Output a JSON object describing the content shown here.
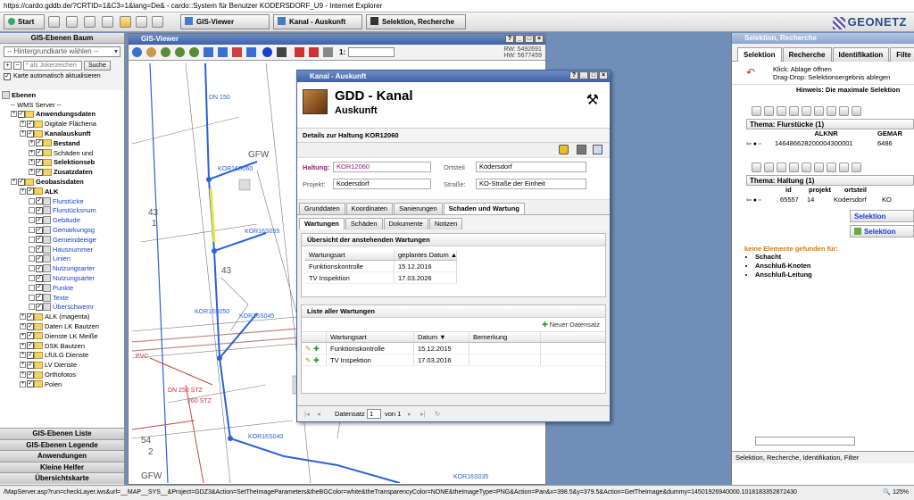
{
  "browser": {
    "title": "https://cardo.gddb.de/?CRTID=1&C3=1&lang=De& - cardo::System für Benutzer KODERSDORF_U9 - Internet Explorer"
  },
  "toolbar": {
    "start_label": "Start",
    "gis_viewer_label": "GIS-Viewer",
    "kanal_auskunft_label": "Kanal - Auskunft",
    "selektion_label": "Selektion, Recherche",
    "logo": "GEONETZ"
  },
  "left": {
    "header": "GIS-Ebenen Baum",
    "dropdown": "-- Hintergrundkarte wählen --",
    "search_placeholder": "* als Jokerzeichen",
    "search_button": "Suche",
    "auto_update": "Karte automatisch aktualisieren",
    "tree": [
      {
        "label": "Ebenen",
        "indent": 0,
        "kind": "root"
      },
      {
        "label": "-- WMS Server --",
        "indent": 1,
        "kind": "plain"
      },
      {
        "label": "Anwendungsdaten",
        "indent": 1,
        "kind": "bold"
      },
      {
        "label": "Digitale Flächena",
        "indent": 2,
        "kind": "folder"
      },
      {
        "label": "Kanalauskunft",
        "indent": 2,
        "kind": "bold"
      },
      {
        "label": "Bestand",
        "indent": 3,
        "kind": "folderbold"
      },
      {
        "label": "Schäden und",
        "indent": 3,
        "kind": "folder"
      },
      {
        "label": "Selektionseb",
        "indent": 3,
        "kind": "folderbold"
      },
      {
        "label": "Zusatzdaten",
        "indent": 3,
        "kind": "folderbold"
      },
      {
        "label": "Geobasisdaten",
        "indent": 1,
        "kind": "bold"
      },
      {
        "label": "ALK",
        "indent": 2,
        "kind": "bold"
      },
      {
        "label": "Flurstücke",
        "indent": 3,
        "kind": "blue"
      },
      {
        "label": "Flurstücksnum",
        "indent": 3,
        "kind": "blue"
      },
      {
        "label": "Gebäude",
        "indent": 3,
        "kind": "blue"
      },
      {
        "label": "Gemarkungsg",
        "indent": 3,
        "kind": "blue"
      },
      {
        "label": "Gemeindeeige",
        "indent": 3,
        "kind": "blue"
      },
      {
        "label": "Hausnummer",
        "indent": 3,
        "kind": "blue"
      },
      {
        "label": "Linien",
        "indent": 3,
        "kind": "blue"
      },
      {
        "label": "Nutzungsarter",
        "indent": 3,
        "kind": "blue"
      },
      {
        "label": "Nutzungsarter",
        "indent": 3,
        "kind": "blue"
      },
      {
        "label": "Punkte",
        "indent": 3,
        "kind": "blue"
      },
      {
        "label": "Texte",
        "indent": 3,
        "kind": "blue"
      },
      {
        "label": "Überschwemr",
        "indent": 3,
        "kind": "blue"
      },
      {
        "label": "ALK (magenta)",
        "indent": 2,
        "kind": "folder"
      },
      {
        "label": "Daten LK Bautzen",
        "indent": 2,
        "kind": "folder"
      },
      {
        "label": "Dienste LK Meiße",
        "indent": 2,
        "kind": "folder"
      },
      {
        "label": "DSK Bautzen",
        "indent": 2,
        "kind": "folder"
      },
      {
        "label": "LfULG Dienste",
        "indent": 2,
        "kind": "folder"
      },
      {
        "label": "LV Dienste",
        "indent": 2,
        "kind": "folder"
      },
      {
        "label": "Orthofotos",
        "indent": 2,
        "kind": "folder"
      },
      {
        "label": "Polen",
        "indent": 2,
        "kind": "folder"
      }
    ],
    "bottom_buttons": [
      "GIS-Ebenen Liste",
      "GIS-Ebenen Legende",
      "Anwendungen",
      "Kleine Helfer",
      "Übersichtskarte"
    ]
  },
  "gis": {
    "title": "GIS-Viewer",
    "scale_label": "1:",
    "rw": "RW: 5492691",
    "hw": "HW: 5677459",
    "map_labels": [
      {
        "t": "DN 150",
        "c": "blue"
      },
      {
        "t": "KOR16S060",
        "c": "blue"
      },
      {
        "t": "KOR16S055",
        "c": "blue"
      },
      {
        "t": "KOR16S050",
        "c": "blue"
      },
      {
        "t": "KOR16S045",
        "c": "blue"
      },
      {
        "t": "KOR16S040",
        "c": "blue"
      },
      {
        "t": "KOR16S035",
        "c": "blue"
      },
      {
        "t": "43",
        "c": "dark"
      },
      {
        "t": "1",
        "c": "dark"
      },
      {
        "t": "43",
        "c": "dark"
      },
      {
        "t": "54",
        "c": "dark"
      },
      {
        "t": "2",
        "c": "dark"
      },
      {
        "t": "GFW",
        "c": "dark"
      },
      {
        "t": "GFW",
        "c": "dark"
      },
      {
        "t": "PVC",
        "c": "red"
      },
      {
        "t": "DN 250 STZ",
        "c": "red"
      },
      {
        "t": "260 STZ",
        "c": "red"
      },
      {
        "t": "KOR16S...",
        "c": "red"
      }
    ]
  },
  "dialog": {
    "window_title": "Kanal - Auskunft",
    "heading": "GDD - Kanal",
    "subheading": "Auskunft",
    "details_title": "Details zur Haltung KOR12060",
    "haltung_label": "Haltung:",
    "haltung_value": "KOR12060",
    "projekt_label": "Projekt:",
    "projekt_value": "Kodersdorf",
    "ortsteil_label": "Ortsteil",
    "ortsteil_value": "Kodersdorf",
    "strasse_label": "Straße:",
    "strasse_value": "KO-Straße der Einheit",
    "tabs": [
      "Grunddaten",
      "Koordinaten",
      "Sanierungen",
      "Schaden und Wartung"
    ],
    "subtabs": [
      "Wartungen",
      "Schäden",
      "Dokumente",
      "Notizen"
    ],
    "overview_title": "Übersicht der anstehenden Wartungen",
    "overview_headers": [
      "Wartungsart",
      "geplantes Datum ▲"
    ],
    "overview_rows": [
      [
        "Funktionskontrolle",
        "15.12.2016"
      ],
      [
        "TV Inspektion",
        "17.03.2026"
      ]
    ],
    "list_title": "Liste aller Wartungen",
    "new_record": "Neuer Datensatz",
    "list_headers": [
      "Wartungsart",
      "Datum ▼",
      "Bemerkung"
    ],
    "list_rows": [
      [
        "Funktionskontrolle",
        "15.12.2015",
        ""
      ],
      [
        "TV Inspektion",
        "17.03.2016",
        ""
      ]
    ],
    "pager_label": "Datensatz",
    "pager_value": "1",
    "pager_of": "von 1"
  },
  "right": {
    "title": "Selektion, Recherche",
    "tabs": [
      "Selektion",
      "Recherche",
      "Identifikation",
      "Filte"
    ],
    "hint1": "Klick: Ablage öffnen",
    "hint2": "Drag-Drop: Selektionsergebnis ablegen",
    "hint3": "Hinweis: Die maximale Selektion",
    "thema1": "Thema: Flurstücke (1)",
    "t1_headers": [
      "ALKNR",
      "GEMAR"
    ],
    "t1_row": [
      "146486628200004300001",
      "6486"
    ],
    "thema2": "Thema: Haltung (1)",
    "t2_headers": [
      "id",
      "projekt",
      "ortsteil"
    ],
    "t2_row": [
      "65557",
      "14",
      "Kodersdorf",
      "KO"
    ],
    "sel_btn1": "Selektion",
    "sel_btn2": "Selektion",
    "none_found": "keine Elemente gefunden für:",
    "none_items": [
      "Schacht",
      "Anschluß-Knoten",
      "Anschluß-Leitung"
    ],
    "footer": "Selektion, Recherche, Identifikation, Filter"
  },
  "status": {
    "url": "/MapServer.asp?run=checkLayer.iws&url=__MAP__SYS__&Project=GDZ3&Action=SetTheImageParameters&theBGColor=white&theTransparencyColor=NONE&theImageType=PNG&Action=Pan&x=398.5&y=379.5&Action=GetTheImage&dummy=14501926940000.1018183352872430",
    "zoom": "125%"
  }
}
